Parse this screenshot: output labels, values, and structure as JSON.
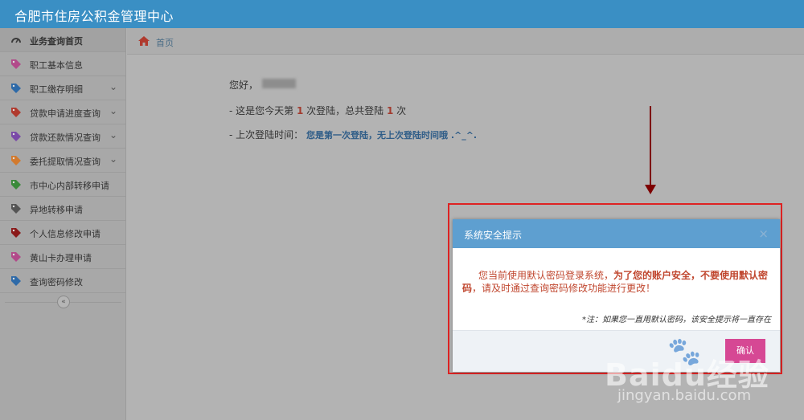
{
  "app": {
    "title": "合肥市住房公积金管理中心"
  },
  "sidebar": {
    "items": [
      {
        "label": "业务查询首页",
        "icon": "dashboard-icon",
        "color": "#3a3a3a",
        "chevron": false
      },
      {
        "label": "职工基本信息",
        "icon": "tag-icon",
        "color": "#b24a8a",
        "chevron": false
      },
      {
        "label": "职工缴存明细",
        "icon": "tag-icon",
        "color": "#2e6aa8",
        "chevron": true
      },
      {
        "label": "贷款申请进度查询",
        "icon": "tag-icon",
        "color": "#b03a2e",
        "chevron": true
      },
      {
        "label": "贷款还款情况查询",
        "icon": "tag-icon",
        "color": "#7a4aa8",
        "chevron": true
      },
      {
        "label": "委托提取情况查询",
        "icon": "tag-icon",
        "color": "#d27a2e",
        "chevron": true
      },
      {
        "label": "市中心内部转移申请",
        "icon": "tag-icon",
        "color": "#3a8a3a",
        "chevron": false
      },
      {
        "label": "异地转移申请",
        "icon": "tag-icon",
        "color": "#555555",
        "chevron": false
      },
      {
        "label": "个人信息修改申请",
        "icon": "tag-icon",
        "color": "#8a1a1a",
        "chevron": false
      },
      {
        "label": "黄山卡办理申请",
        "icon": "tag-icon",
        "color": "#b24a8a",
        "chevron": false
      },
      {
        "label": "查询密码修改",
        "icon": "tag-icon",
        "color": "#2e6aa8",
        "chevron": false
      }
    ],
    "collapse_glyph": "«"
  },
  "breadcrumb": {
    "label": "首页"
  },
  "main": {
    "greeting": "您好，",
    "line1": {
      "prefix": "- 这是您今天第 ",
      "today_count": "1",
      "middle": " 次登陆，总共登陆 ",
      "total_count": "1",
      "suffix": " 次"
    },
    "line2": {
      "prefix": "- 上次登陆时间：",
      "value": "您是第一次登陆，无上次登陆时间哦 .^_^."
    }
  },
  "dialog": {
    "title": "系统安全提示",
    "close": "×",
    "body_normal1": "您当前使用默认密码登录系统，",
    "body_bold": "为了您的账户安全，不要使用默认密码",
    "body_normal2": "，请及时通过查询密码修改功能进行更改！",
    "note": "*注：如果您一直用默认密码，该安全提示将一直存在",
    "ok_label": "确认"
  },
  "watermark": {
    "text": "Baidu经验",
    "url": "jingyan.baidu.com"
  },
  "colors": {
    "topbar": "#3a8fc4",
    "dialog_header": "#5e9fd0",
    "ok_button": "#d64894",
    "highlight": "#dd2222",
    "arrow": "#7d0000"
  }
}
